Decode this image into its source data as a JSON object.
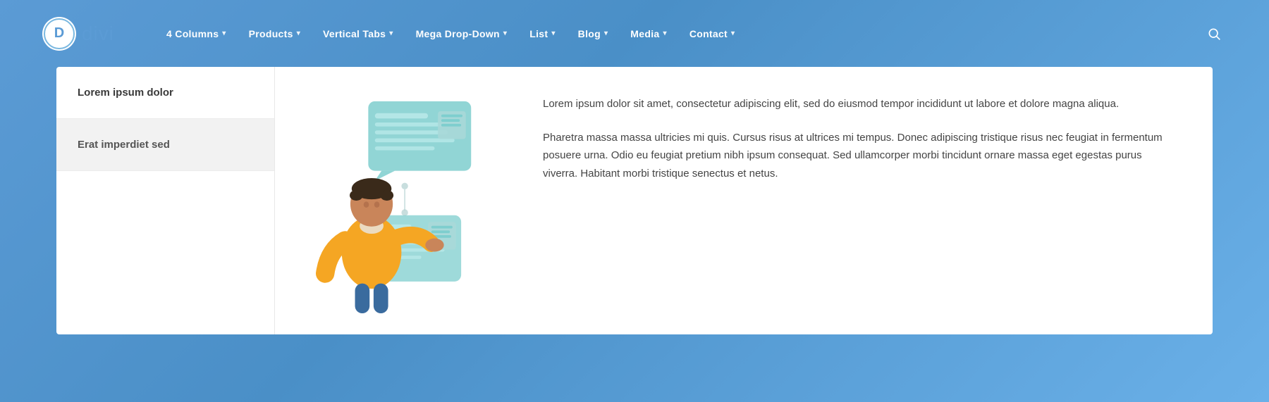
{
  "logo": {
    "letter": "D",
    "text": "divi"
  },
  "nav": {
    "items": [
      {
        "label": "4 Columns",
        "hasDropdown": true
      },
      {
        "label": "Products",
        "hasDropdown": true
      },
      {
        "label": "Vertical Tabs",
        "hasDropdown": true
      },
      {
        "label": "Mega Drop-Down",
        "hasDropdown": true
      },
      {
        "label": "List",
        "hasDropdown": true
      },
      {
        "label": "Blog",
        "hasDropdown": true
      },
      {
        "label": "Media",
        "hasDropdown": true
      },
      {
        "label": "Contact",
        "hasDropdown": true
      }
    ]
  },
  "sidebar": {
    "item1": "Lorem ipsum dolor",
    "item2": "Erat imperdiet sed"
  },
  "text": {
    "paragraph1": "Lorem ipsum dolor sit amet, consectetur adipiscing elit, sed do eiusmod tempor incididunt ut labore et dolore magna aliqua.",
    "paragraph2": "Pharetra massa massa ultricies mi quis. Cursus risus at ultrices mi tempus. Donec adipiscing tristique risus nec feugiat in fermentum posuere urna. Odio eu feugiat pretium nibh ipsum consequat. Sed ullamcorper morbi tincidunt ornare massa eget egestas purus viverra. Habitant morbi tristique senectus et netus."
  },
  "icons": {
    "search": "search-icon",
    "chevron": "▾"
  },
  "colors": {
    "navBg": "linear-gradient(135deg, #5b9bd5 0%, #4a8fc7 40%, #6ab0e8 100%)",
    "accent": "#5b9bd5",
    "teal": "#7ecece",
    "tealLight": "#a8e0e0",
    "personBody": "#f5a623",
    "personHead": "#c9855a",
    "sidebarGray": "#f2f2f2"
  }
}
